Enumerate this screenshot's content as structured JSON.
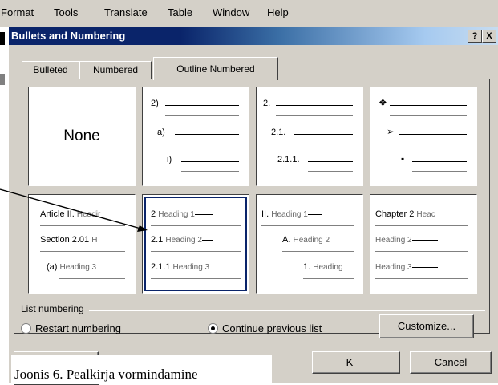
{
  "menubar": {
    "items": [
      "Format",
      "Tools",
      "Translate",
      "Table",
      "Window",
      "Help"
    ]
  },
  "dialog": {
    "title": "Bullets and Numbering",
    "help_label": "?",
    "close_label": "X",
    "tabs": [
      {
        "label": "Bulleted",
        "active": false
      },
      {
        "label": "Numbered",
        "active": false
      },
      {
        "label": "Outline Numbered",
        "active": true
      }
    ],
    "tiles": [
      {
        "name": "none",
        "label": "None"
      },
      {
        "name": "numeric-paren",
        "lines": [
          "2)",
          "a)",
          "i)"
        ]
      },
      {
        "name": "decimal",
        "lines": [
          "2.",
          "2.1.",
          "2.1.1."
        ]
      },
      {
        "name": "bullets",
        "lines": [
          "❖",
          "➢",
          "▪"
        ]
      },
      {
        "name": "article",
        "lines": [
          [
            "Article II.",
            "Headir"
          ],
          [
            "Section 2.01",
            "H"
          ],
          [
            "(a)",
            "Heading 3"
          ]
        ]
      },
      {
        "name": "heading-decimal",
        "lines": [
          [
            "2",
            "Heading 1"
          ],
          [
            "2.1",
            "Heading 2"
          ],
          [
            "2.1.1",
            "Heading 3"
          ]
        ]
      },
      {
        "name": "heading-roman",
        "lines": [
          [
            "II.",
            "Heading 1"
          ],
          [
            "A.",
            "Heading 2"
          ],
          [
            "1.",
            "Heading"
          ]
        ]
      },
      {
        "name": "chapter",
        "lines": [
          [
            "Chapter 2",
            "Heac"
          ],
          [
            "",
            "Heading 2"
          ],
          [
            "",
            "Heading 3"
          ]
        ]
      }
    ],
    "list_numbering": {
      "group_label": "List numbering",
      "restart_label": "Restart numbering",
      "continue_label": "Continue previous list",
      "selected": "continue"
    },
    "customize_label": "Customize...",
    "ok_label": "OK",
    "ok_visible_label": "K",
    "cancel_label": "Cancel"
  },
  "caption": "Joonis 6. Pealkirja vormindamine"
}
